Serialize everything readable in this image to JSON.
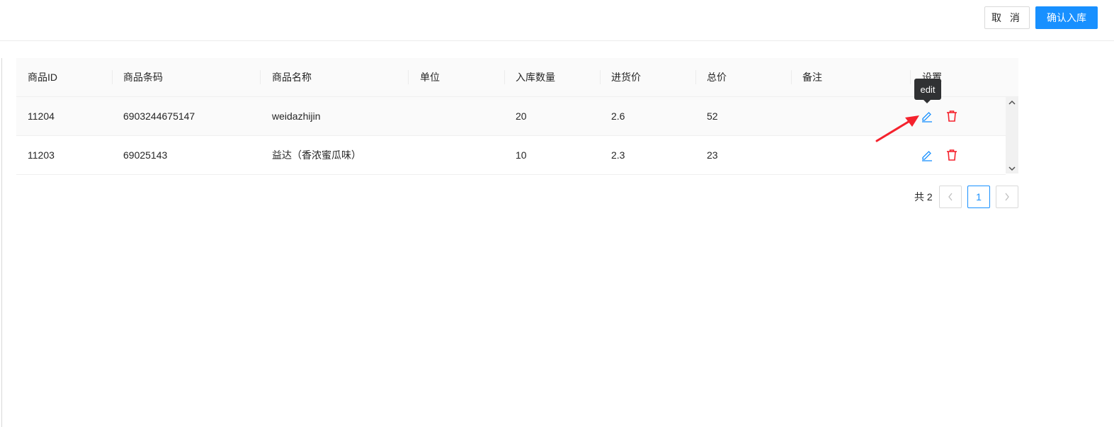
{
  "toolbar": {
    "cancel_label": "取 消",
    "confirm_label": "确认入库"
  },
  "table": {
    "columns": [
      "商品ID",
      "商品条码",
      "商品名称",
      "单位",
      "入库数量",
      "进货价",
      "总价",
      "备注",
      "设置"
    ],
    "rows": [
      {
        "id": "11204",
        "barcode": "6903244675147",
        "name": "weidazhijin",
        "unit": "",
        "qty": "20",
        "price": "2.6",
        "total": "52",
        "note": ""
      },
      {
        "id": "11203",
        "barcode": "69025143",
        "name": "益达（香浓蜜瓜味）",
        "unit": "",
        "qty": "10",
        "price": "2.3",
        "total": "23",
        "note": ""
      }
    ]
  },
  "tooltip": {
    "text": "edit"
  },
  "pagination": {
    "total_label": "共 2",
    "current_page": "1"
  },
  "icons": {
    "edit": "edit-icon",
    "delete": "delete-icon",
    "prev": "chevron-left-icon",
    "next": "chevron-right-icon"
  },
  "colors": {
    "primary": "#1890ff",
    "danger": "#f5222d",
    "annotation_arrow": "#f5222d",
    "tooltip_bg": "#303133"
  }
}
